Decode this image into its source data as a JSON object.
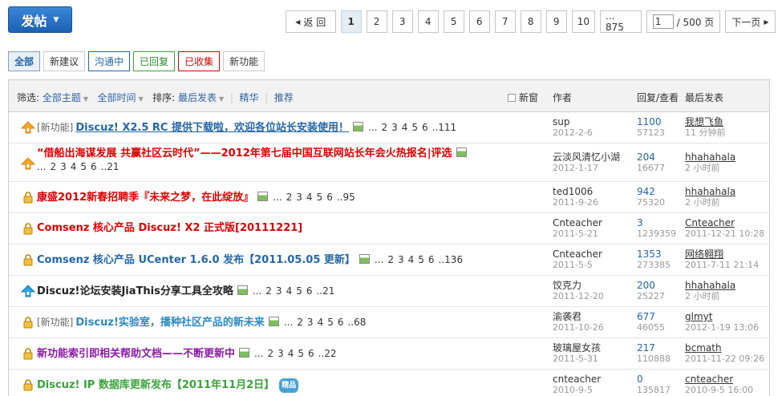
{
  "post_button": {
    "label": "发帖"
  },
  "pager": {
    "prev": "返 回",
    "pages": [
      "1",
      "2",
      "3",
      "4",
      "5",
      "6",
      "7",
      "8",
      "9",
      "10"
    ],
    "last": "... 875",
    "jump_value": "1",
    "total": "/ 500 页",
    "next": "下一页"
  },
  "tabs": [
    "全部",
    "新建议",
    "沟通中",
    "已回复",
    "已收集",
    "新功能"
  ],
  "header": {
    "filter_label": "筛选:",
    "all_topics": "全部主题",
    "all_time": "全部时间",
    "sort_label": "排序:",
    "sort_value": "最后发表",
    "digest": "精华",
    "recommend": "推荐",
    "new_window": "新窗",
    "author": "作者",
    "replies": "回复/查看",
    "last_post": "最后发表"
  },
  "threads": [
    {
      "icon": "announce-icon",
      "type": "[新功能]",
      "title": "Discuz! X2.5 RC 提供下载啦，欢迎各位站长安装使用！",
      "color": "#2366a8",
      "pages": [
        "...",
        "2",
        "3",
        "4",
        "5",
        "6",
        "..111"
      ],
      "author": "sup",
      "date": "2012-2-6",
      "replies": "1100",
      "views": "57123",
      "last_user": "我想飞鱼",
      "last_time": "11 分钟前"
    },
    {
      "icon": "announce-icon",
      "type": "",
      "title": "“借船出海谋发展 共赢社区云时代”——2012年第七届中国互联网站长年会火热报名|评选",
      "color": "#d00",
      "pages": [
        "...",
        "2",
        "3",
        "4",
        "5",
        "6",
        "..21"
      ],
      "author": "云淡风清忆小湖",
      "date": "2012-1-17",
      "replies": "204",
      "views": "16677",
      "last_user": "hhahahala",
      "last_time": "2 小时前"
    },
    {
      "icon": "lock-icon",
      "type": "",
      "title": "康盛2012新春招聘季『未来之梦，在此绽放』",
      "color": "#d00",
      "pages": [
        "...",
        "2",
        "3",
        "4",
        "5",
        "6",
        "..95"
      ],
      "author": "ted1006",
      "date": "2011-9-26",
      "replies": "942",
      "views": "75320",
      "last_user": "hhahahala",
      "last_time": "2 小时前"
    },
    {
      "icon": "lock-icon",
      "type": "",
      "title": "Comsenz 核心产品 Discuz! X2 正式版[20111221]",
      "color": "#d00",
      "pages": [],
      "author": "Cnteacher",
      "date": "2011-5-21",
      "replies": "3",
      "views": "1239359",
      "last_user": "Cnteacher",
      "last_time": "2011-12-21 10:28"
    },
    {
      "icon": "lock-icon",
      "type": "",
      "title": "Comsenz 核心产品 UCenter 1.6.0 发布【2011.05.05 更新】",
      "color": "#2366a8",
      "pages": [
        "...",
        "2",
        "3",
        "4",
        "5",
        "6",
        "..136"
      ],
      "author": "Cnteacher",
      "date": "2011-5-5",
      "replies": "1353",
      "views": "273385",
      "last_user": "网络翱翔",
      "last_time": "2011-7-11 21:14"
    },
    {
      "icon": "pin-icon",
      "type": "",
      "title": "Discuz!论坛安装JiaThis分享工具全攻略",
      "color": "#222",
      "pages": [
        "...",
        "2",
        "3",
        "4",
        "5",
        "6",
        "..21"
      ],
      "author": "饺克力",
      "date": "2011-12-20",
      "replies": "200",
      "views": "25227",
      "last_user": "hhahahala",
      "last_time": "2 小时前"
    },
    {
      "icon": "lock-icon",
      "type": "[新功能]",
      "title": "Discuz!实验室，播种社区产品的新未来",
      "color": "#2b89c4",
      "pages": [
        "...",
        "2",
        "3",
        "4",
        "5",
        "6",
        "..68"
      ],
      "author": "渝袭君",
      "date": "2011-10-26",
      "replies": "677",
      "views": "46055",
      "last_user": "glmyt",
      "last_time": "2012-1-19 13:06"
    },
    {
      "icon": "lock-icon",
      "type": "",
      "title": "新功能索引即相关帮助文档——不断更新中",
      "color": "#8a1aa5",
      "pages": [
        "...",
        "2",
        "3",
        "4",
        "5",
        "6",
        "..22"
      ],
      "author": "玻璃屋女孩",
      "date": "2011-5-31",
      "replies": "217",
      "views": "110888",
      "last_user": "bcmath",
      "last_time": "2011-11-22 09:26"
    },
    {
      "icon": "lock-icon",
      "type": "",
      "title": "Discuz! IP 数据库更新发布【2011年11月2日】",
      "color": "#3aa33a",
      "pages": [],
      "badge": "精品",
      "author": "cnteacher",
      "date": "2010-9-5",
      "replies": "0",
      "views": "135817",
      "last_user": "cnteacher",
      "last_time": "2010-9-5 16:00"
    }
  ]
}
